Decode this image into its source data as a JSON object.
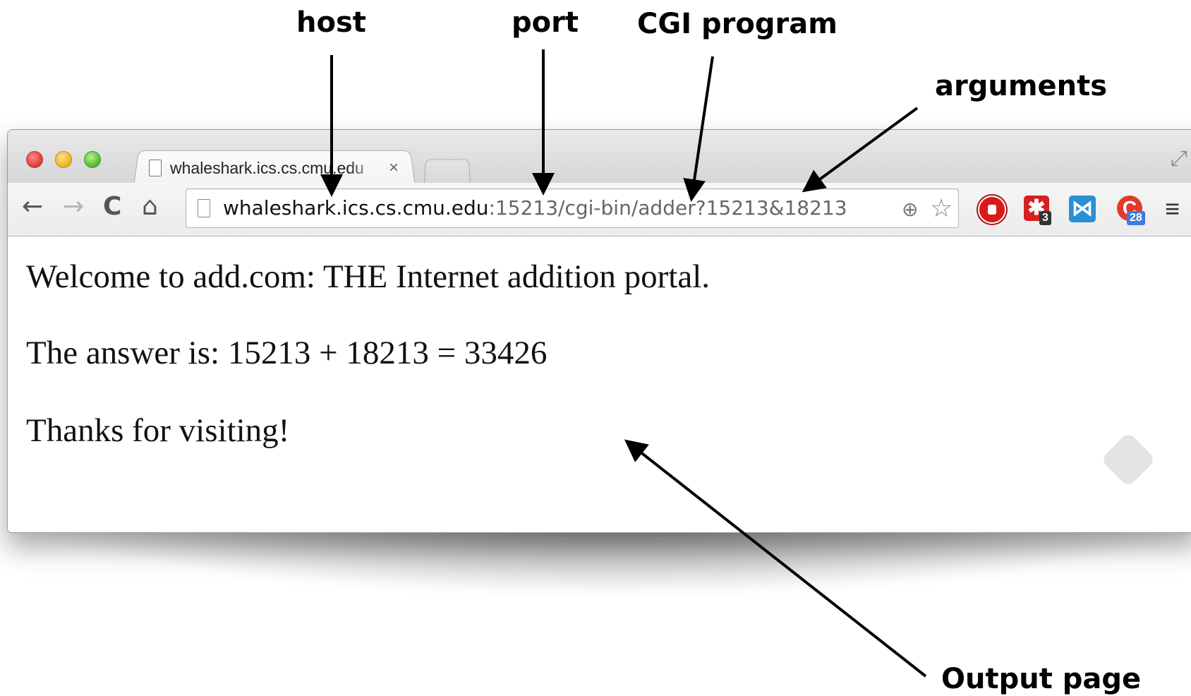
{
  "annotations": {
    "host": "host",
    "port": "port",
    "cgi_program": "CGI program",
    "arguments": "arguments",
    "output_page": "Output page"
  },
  "browser": {
    "tab_title": "whaleshark.ics.cs.cmu.edu",
    "tab_close": "×",
    "url_host": "whaleshark.ics.cs.cmu.edu",
    "url_rest": ":15213/cgi-bin/adder?15213&18213",
    "extensions": [
      {
        "name": "stop-icon",
        "color": "#d71b1b"
      },
      {
        "name": "lastpass-icon",
        "color": "#d42121",
        "badge": "3"
      },
      {
        "name": "blue-extension-icon",
        "color": "#2a8fd6"
      },
      {
        "name": "c-extension-icon",
        "color": "#e23b2e",
        "badge": "28"
      }
    ],
    "icons": {
      "back": "←",
      "forward": "→",
      "reload": "C",
      "home": "⌂",
      "zoom": "⊕",
      "star": "☆",
      "menu": "≡",
      "fullscreen": "⤢"
    }
  },
  "page": {
    "line1": "Welcome to add.com: THE Internet addition portal.",
    "line2": "The answer is: 15213 + 18213 = 33426",
    "line3": "Thanks for visiting!"
  }
}
